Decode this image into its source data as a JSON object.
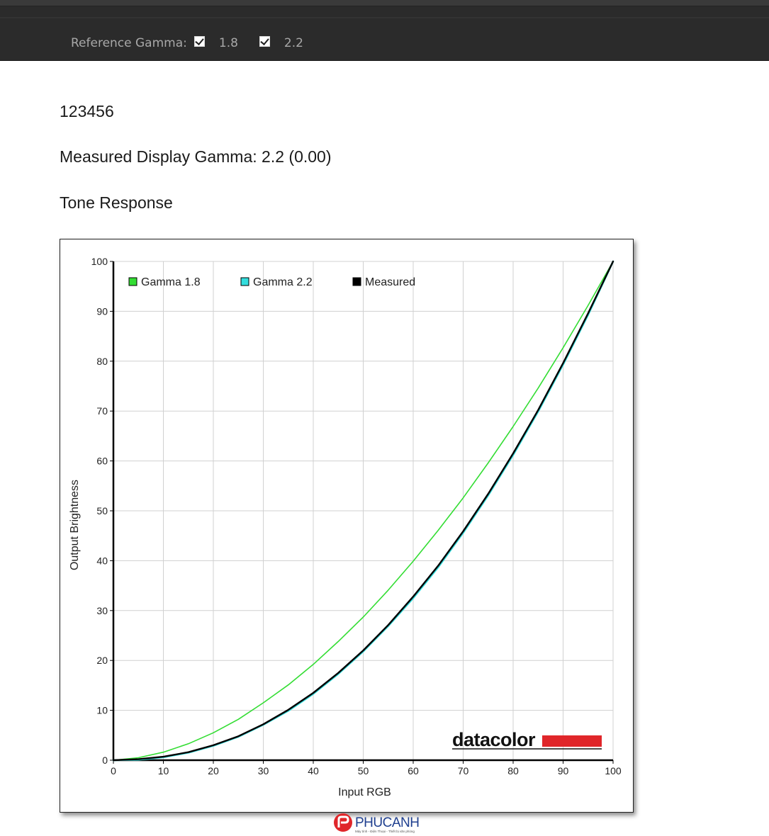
{
  "reference_gamma": {
    "label": "Reference Gamma:",
    "options": [
      {
        "label": "1.8",
        "checked": true
      },
      {
        "label": "2.2",
        "checked": true
      }
    ]
  },
  "header_lines": {
    "device_id": "123456",
    "measured_gamma": "Measured Display Gamma: 2.2 (0.00)",
    "section_title": "Tone Response"
  },
  "chart_data": {
    "type": "line",
    "title": "",
    "xlabel": "Input RGB",
    "ylabel": "Output Brightness",
    "xlim": [
      0,
      100
    ],
    "ylim": [
      0,
      100
    ],
    "xticks": [
      0,
      10,
      20,
      30,
      40,
      50,
      60,
      70,
      80,
      90,
      100
    ],
    "yticks": [
      0,
      10,
      20,
      30,
      40,
      50,
      60,
      70,
      80,
      90,
      100
    ],
    "grid": true,
    "legend_position": "top-left",
    "series": [
      {
        "name": "Gamma 1.8",
        "color": "#33dd33",
        "x": [
          0,
          5,
          10,
          15,
          20,
          25,
          30,
          35,
          40,
          45,
          50,
          55,
          60,
          65,
          70,
          75,
          80,
          85,
          90,
          95,
          100
        ],
        "values": [
          0,
          0.5,
          1.6,
          3.3,
          5.5,
          8.2,
          11.5,
          15.1,
          19.2,
          23.8,
          28.7,
          34.1,
          39.9,
          46.1,
          52.6,
          59.6,
          66.9,
          74.6,
          82.7,
          91.2,
          100
        ]
      },
      {
        "name": "Gamma 2.2",
        "color": "#33dddd",
        "x": [
          0,
          5,
          10,
          15,
          20,
          25,
          30,
          35,
          40,
          45,
          50,
          55,
          60,
          65,
          70,
          75,
          80,
          85,
          90,
          95,
          100
        ],
        "values": [
          0,
          0.1,
          0.6,
          1.5,
          2.9,
          4.7,
          7.1,
          9.9,
          13.3,
          17.3,
          21.8,
          26.9,
          32.5,
          38.7,
          45.6,
          53.1,
          61.2,
          69.9,
          79.3,
          89.3,
          100
        ]
      },
      {
        "name": "Measured",
        "color": "#000000",
        "x": [
          0,
          5,
          10,
          15,
          20,
          25,
          30,
          35,
          40,
          45,
          50,
          55,
          60,
          65,
          70,
          75,
          80,
          85,
          90,
          95,
          100
        ],
        "values": [
          0,
          0.2,
          0.7,
          1.6,
          3.0,
          4.8,
          7.2,
          10.1,
          13.5,
          17.5,
          22.0,
          27.1,
          32.8,
          39.0,
          45.9,
          53.4,
          61.5,
          70.2,
          79.6,
          89.6,
          100
        ]
      }
    ]
  },
  "logos": {
    "chart_brand": "datacolor",
    "brand_bar_color": "#e0262a",
    "site_brand": "PHUCANH",
    "site_tagline": "Máy tính - Điện Thoại - Thiết bị văn phòng",
    "site_brand_color": "#e0262a"
  }
}
